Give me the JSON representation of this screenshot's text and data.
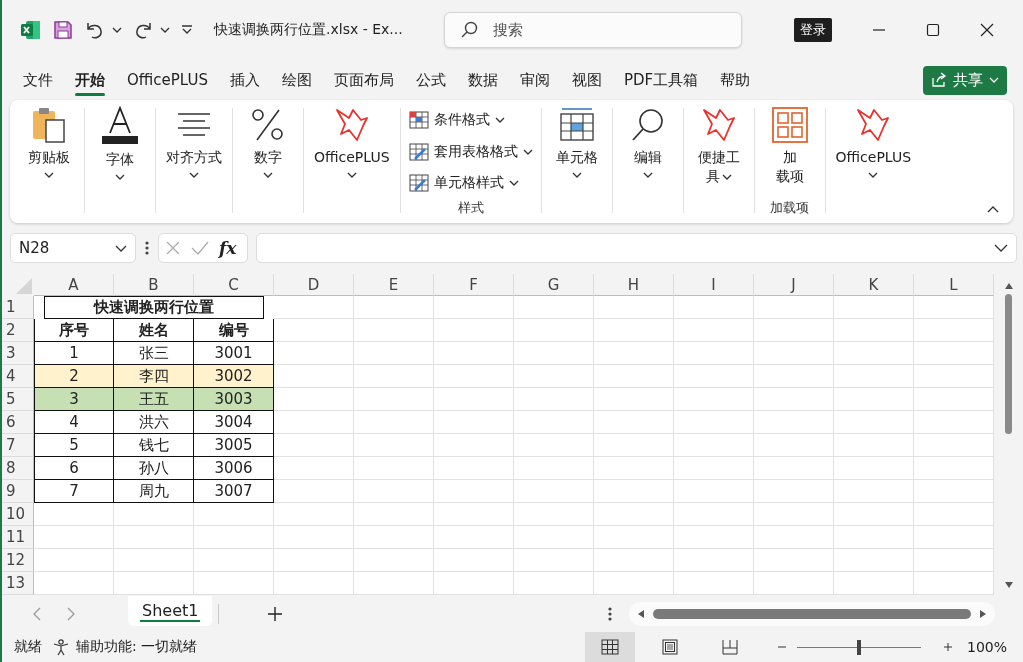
{
  "window": {
    "title": "快速调换两行位置.xlsx  -  Ex...",
    "search": {
      "placeholder": "搜索"
    },
    "signin": "登录"
  },
  "menu_tabs": [
    {
      "label": "文件",
      "selected": false
    },
    {
      "label": "开始",
      "selected": true
    },
    {
      "label": "OfficePLUS",
      "selected": false
    },
    {
      "label": "插入",
      "selected": false
    },
    {
      "label": "绘图",
      "selected": false
    },
    {
      "label": "页面布局",
      "selected": false
    },
    {
      "label": "公式",
      "selected": false
    },
    {
      "label": "数据",
      "selected": false
    },
    {
      "label": "审阅",
      "selected": false
    },
    {
      "label": "视图",
      "selected": false
    },
    {
      "label": "PDF工具箱",
      "selected": false
    },
    {
      "label": "帮助",
      "selected": false
    }
  ],
  "share_button": "共享",
  "ribbon": [
    {
      "kind": "big",
      "lines": [
        "剪贴板"
      ],
      "dropdown": true
    },
    {
      "kind": "big",
      "lines": [
        "字体"
      ],
      "dropdown": true
    },
    {
      "kind": "big",
      "lines": [
        "对齐方式"
      ],
      "dropdown": true
    },
    {
      "kind": "big",
      "lines": [
        "数字"
      ],
      "dropdown": true
    },
    {
      "kind": "big",
      "lines": [
        "OfficePLUS"
      ],
      "dropdown": true
    },
    {
      "kind": "stack",
      "items": [
        "条件格式",
        "套用表格格式",
        "单元格样式"
      ],
      "group_label": "样式"
    },
    {
      "kind": "big",
      "lines": [
        "单元格"
      ],
      "dropdown": true
    },
    {
      "kind": "big",
      "lines": [
        "编辑"
      ],
      "dropdown": true
    },
    {
      "kind": "big",
      "lines": [
        "便捷工",
        "具"
      ],
      "dropdown": true
    },
    {
      "kind": "big",
      "lines": [
        "加",
        "载项"
      ],
      "dropdown": false,
      "group_label": "加载项"
    },
    {
      "kind": "big",
      "lines": [
        "OfficePLUS"
      ],
      "dropdown": true
    }
  ],
  "formula_bar": {
    "name_box": "N28",
    "fx": "fx"
  },
  "sheet": {
    "columns": [
      "A",
      "B",
      "C",
      "D",
      "E",
      "F",
      "G",
      "H",
      "I",
      "J",
      "K",
      "L"
    ],
    "rows": [
      {
        "number": "1",
        "kind": "title",
        "cells": [
          "快速调换两行位置"
        ]
      },
      {
        "number": "2",
        "kind": "header",
        "cells": [
          "序号",
          "姓名",
          "编号"
        ]
      },
      {
        "number": "3",
        "kind": "data",
        "cells": [
          "1",
          "张三",
          "3001"
        ]
      },
      {
        "number": "4",
        "kind": "data",
        "cells": [
          "2",
          "李四",
          "3002"
        ],
        "color": "#fff2cc"
      },
      {
        "number": "5",
        "kind": "data",
        "cells": [
          "3",
          "王五",
          "3003"
        ],
        "color": "#c6e0b4"
      },
      {
        "number": "6",
        "kind": "data",
        "cells": [
          "4",
          "洪六",
          "3004"
        ]
      },
      {
        "number": "7",
        "kind": "data",
        "cells": [
          "5",
          "钱七",
          "3005"
        ]
      },
      {
        "number": "8",
        "kind": "data",
        "cells": [
          "6",
          "孙八",
          "3006"
        ]
      },
      {
        "number": "9",
        "kind": "data",
        "cells": [
          "7",
          "周九",
          "3007"
        ]
      },
      {
        "number": "10",
        "kind": "empty"
      },
      {
        "number": "11",
        "kind": "empty"
      },
      {
        "number": "12",
        "kind": "empty"
      },
      {
        "number": "13",
        "kind": "empty"
      }
    ]
  },
  "sheet_tabs": [
    {
      "label": "Sheet1",
      "selected": true
    }
  ],
  "status_bar": {
    "ready": "就绪",
    "accessibility": "辅助功能: 一切就绪",
    "zoom": {
      "level": 0.5,
      "reading": "100%"
    }
  }
}
